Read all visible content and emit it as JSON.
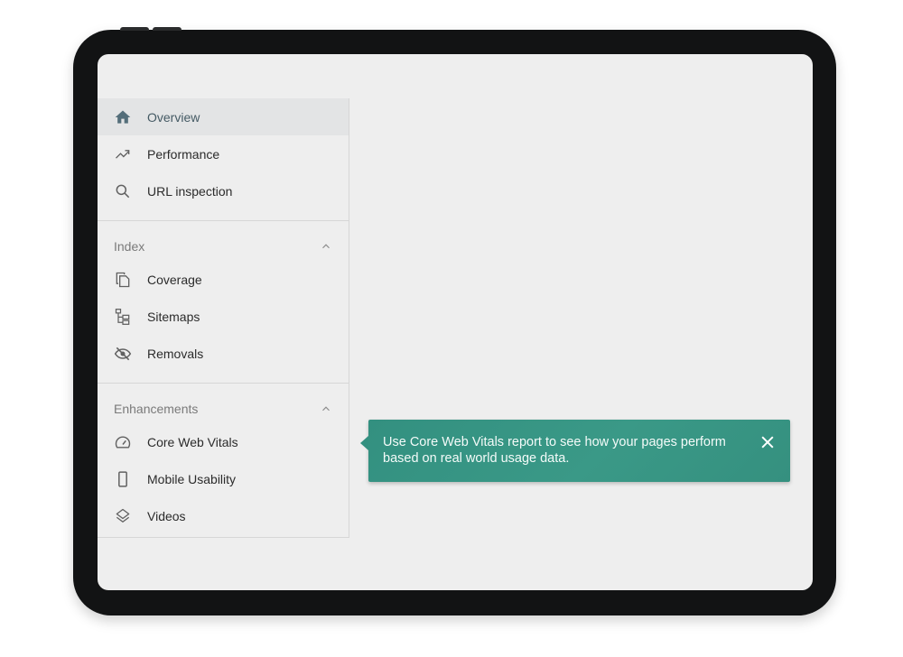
{
  "sidebar": {
    "top_items": [
      {
        "label": "Overview",
        "icon": "home-icon",
        "active": true
      },
      {
        "label": "Performance",
        "icon": "trending-up-icon",
        "active": false
      },
      {
        "label": "URL inspection",
        "icon": "search-icon",
        "active": false
      }
    ],
    "sections": [
      {
        "title": "Index",
        "expanded": true,
        "items": [
          {
            "label": "Coverage",
            "icon": "copy-icon"
          },
          {
            "label": "Sitemaps",
            "icon": "sitemap-icon"
          },
          {
            "label": "Removals",
            "icon": "eye-off-icon"
          }
        ]
      },
      {
        "title": "Enhancements",
        "expanded": true,
        "items": [
          {
            "label": "Core Web Vitals",
            "icon": "speed-gauge-icon"
          },
          {
            "label": "Mobile Usability",
            "icon": "smartphone-icon"
          },
          {
            "label": "Videos",
            "icon": "layers-icon"
          }
        ]
      }
    ]
  },
  "tooltip": {
    "text": "Use Core Web Vitals report to see how your pages perform based on real world usage data.",
    "close_icon": "close-icon",
    "background_color": "#38968a"
  },
  "colors": {
    "active_item_bg": "#e3e4e5",
    "active_icon": "#546e7a",
    "icon_default": "#616161"
  }
}
